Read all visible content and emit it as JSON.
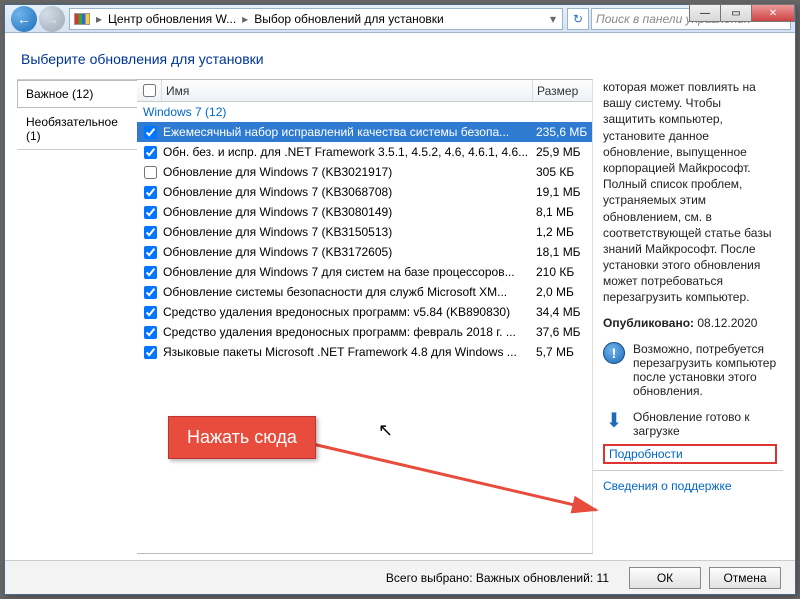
{
  "window": {
    "breadcrumb_root": "Центр обновления W...",
    "breadcrumb_leaf": "Выбор обновлений для установки",
    "search_placeholder": "Поиск в панели управления"
  },
  "page": {
    "title": "Выберите обновления для установки"
  },
  "tabs": {
    "important": "Важное (12)",
    "optional": "Необязательное (1)"
  },
  "columns": {
    "name": "Имя",
    "size": "Размер"
  },
  "group": {
    "label": "Windows 7 (12)"
  },
  "updates": [
    {
      "checked": true,
      "selected": true,
      "name": "Ежемесячный набор исправлений качества системы безопа...",
      "size": "235,6 МБ"
    },
    {
      "checked": true,
      "selected": false,
      "name": "Обн. без. и испр. для .NET Framework 3.5.1, 4.5.2, 4.6, 4.6.1, 4.6...",
      "size": "25,9 МБ"
    },
    {
      "checked": false,
      "selected": false,
      "name": "Обновление для Windows 7 (KB3021917)",
      "size": "305 КБ"
    },
    {
      "checked": true,
      "selected": false,
      "name": "Обновление для Windows 7 (KB3068708)",
      "size": "19,1 МБ"
    },
    {
      "checked": true,
      "selected": false,
      "name": "Обновление для Windows 7 (KB3080149)",
      "size": "8,1 МБ"
    },
    {
      "checked": true,
      "selected": false,
      "name": "Обновление для Windows 7 (KB3150513)",
      "size": "1,2 МБ"
    },
    {
      "checked": true,
      "selected": false,
      "name": "Обновление для Windows 7 (KB3172605)",
      "size": "18,1 МБ"
    },
    {
      "checked": true,
      "selected": false,
      "name": "Обновление для Windows 7 для систем на базе процессоров...",
      "size": "210 КБ"
    },
    {
      "checked": true,
      "selected": false,
      "name": "Обновление системы безопасности для служб Microsoft XM...",
      "size": "2,0 МБ"
    },
    {
      "checked": true,
      "selected": false,
      "name": "Средство удаления вредоносных программ: v5.84 (KB890830)",
      "size": "34,4 МБ"
    },
    {
      "checked": true,
      "selected": false,
      "name": "Средство удаления вредоносных программ: февраль 2018 г. ...",
      "size": "37,6 МБ"
    },
    {
      "checked": true,
      "selected": false,
      "name": "Языковые пакеты Microsoft .NET Framework 4.8 для Windows ...",
      "size": "5,7 МБ"
    }
  ],
  "details": {
    "description": "которая может повлиять на вашу систему. Чтобы защитить компьютер, установите данное обновление, выпущенное корпорацией Майкрософт. Полный список проблем, устраняемых этим обновлением, см. в соответствующей статье базы знаний Майкрософт. После установки этого обновления может потребоваться перезагрузить компьютер.",
    "published_label": "Опубликовано:",
    "published_date": "08.12.2020",
    "restart_note": "Возможно, потребуется перезагрузить компьютер после установки этого обновления.",
    "download_ready": "Обновление готово к загрузке",
    "details_link": "Подробности",
    "support_link": "Сведения о поддержке"
  },
  "footer": {
    "status_prefix": "Всего выбрано: Важных обновлений:",
    "status_count": "11",
    "ok": "ОК",
    "cancel": "Отмена"
  },
  "annotation": {
    "callout": "Нажать сюда"
  }
}
